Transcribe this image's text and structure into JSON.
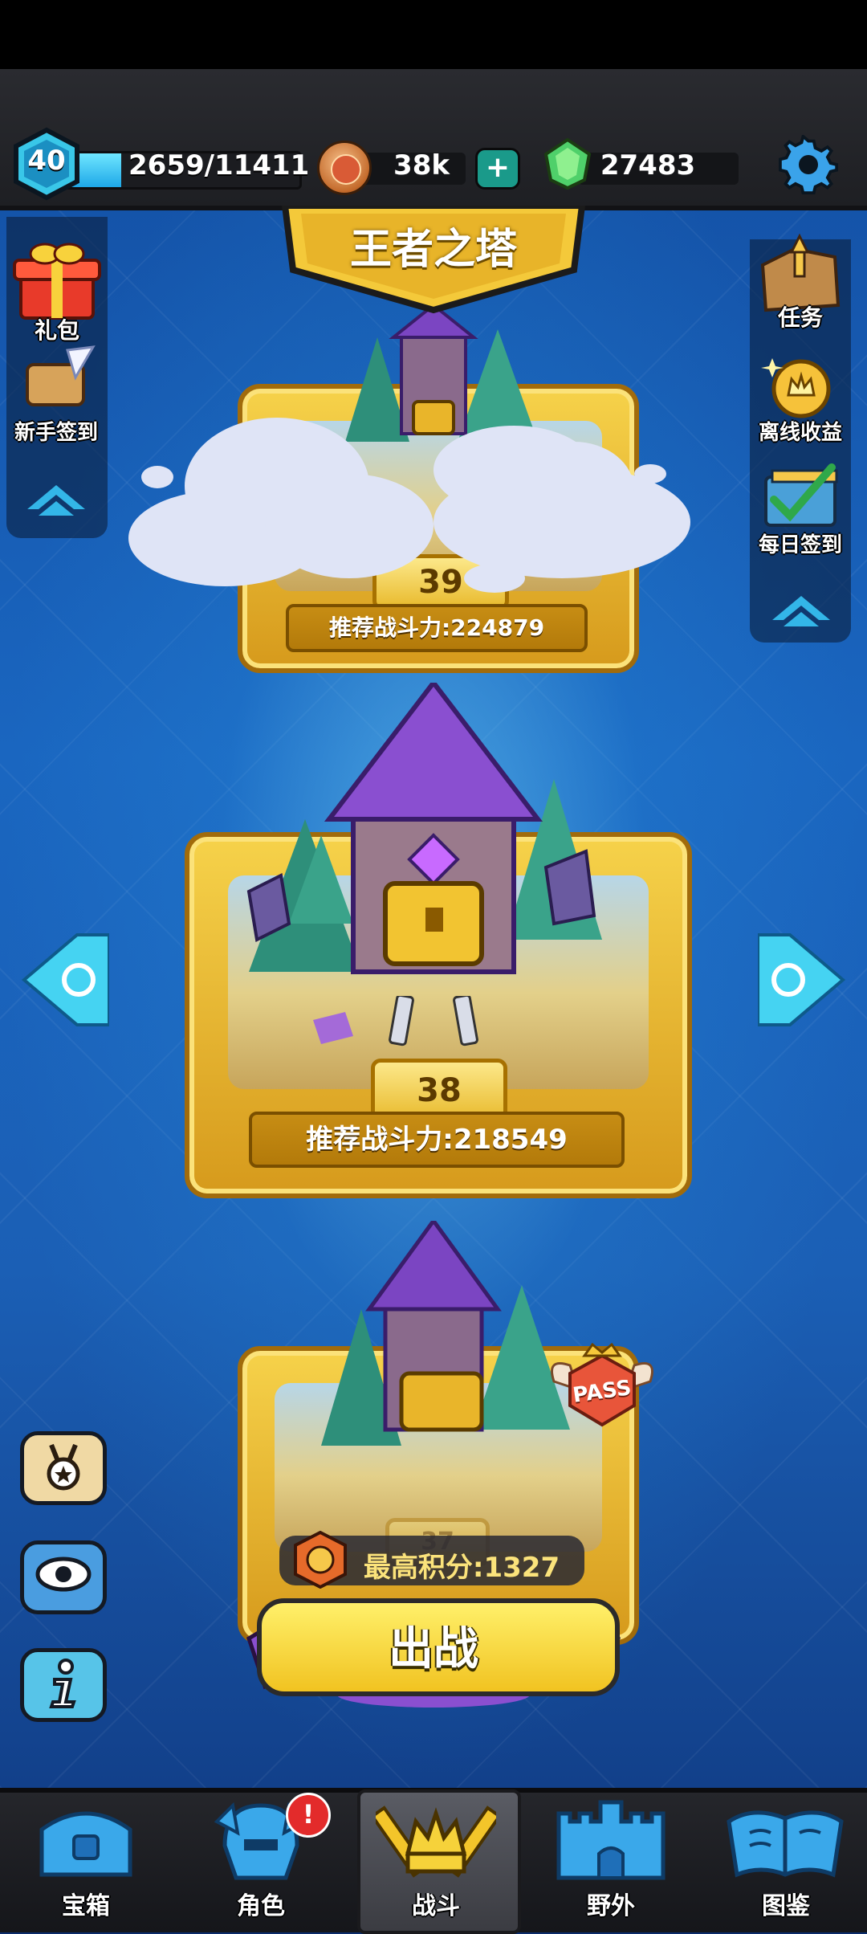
{
  "player": {
    "level": "40",
    "xp_text": "2659/11411",
    "xp_fraction": 0.233
  },
  "currency": {
    "coins": "38k",
    "gems": "27483"
  },
  "title": "王者之塔",
  "left_side": {
    "gift_label": "礼包",
    "newbie_signin_label": "新手签到"
  },
  "right_side": {
    "task_label": "任务",
    "offline_income_label": "离线收益",
    "daily_signin_label": "每日签到"
  },
  "floors": {
    "upper": {
      "level": "39",
      "recommended": "推荐战斗力:224879"
    },
    "current": {
      "level": "38",
      "recommended": "推荐战斗力:218549"
    },
    "lower": {
      "level": "37"
    }
  },
  "best_score": "最高积分:1327",
  "pass_label": "PASS",
  "fight_button": "出战",
  "nav": {
    "chest": "宝箱",
    "character": "角色",
    "battle": "战斗",
    "wild": "野外",
    "codex": "图鉴",
    "character_badge": "!"
  },
  "colors": {
    "accent_gold": "#f1c321",
    "xp_blue": "#1ea8e8",
    "gem_green": "#4fd06a"
  }
}
